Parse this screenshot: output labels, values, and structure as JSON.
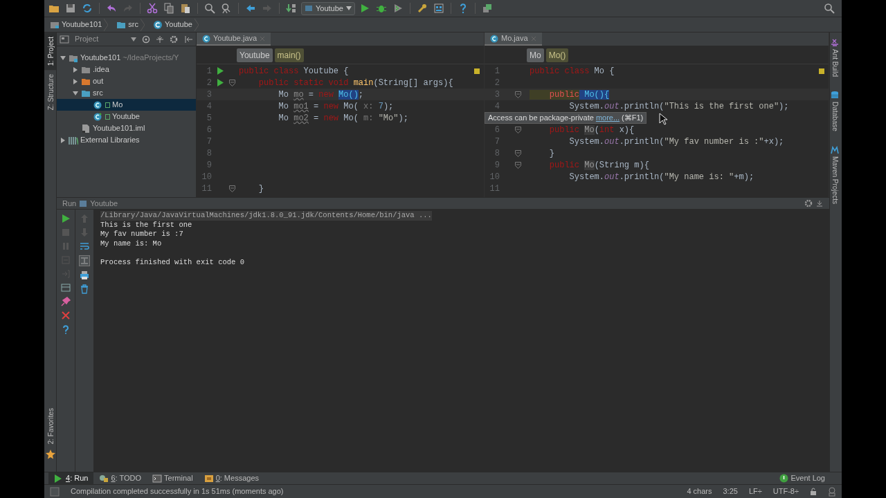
{
  "toolbar": {
    "run_config": "Youtube"
  },
  "breadcrumbs": [
    "Youtube101",
    "src",
    "Youtube"
  ],
  "left_strip": {
    "top": [
      {
        "label": "1: Project",
        "selected": true
      },
      {
        "label": "Z: Structure",
        "selected": false
      }
    ],
    "bottom": [
      {
        "label": "2: Favorites",
        "selected": false
      }
    ]
  },
  "right_strip": [
    {
      "label": "Ant Build",
      "kind": "ant"
    },
    {
      "label": "Database",
      "kind": "database"
    },
    {
      "label": "Maven Projects",
      "kind": "maven"
    }
  ],
  "project_panel": {
    "title": "Project",
    "tree": [
      {
        "label": "Youtube101",
        "hint": "~/IdeaProjects/Y",
        "kind": "module",
        "expanded": true,
        "selected": false,
        "children": [
          {
            "label": ".idea",
            "kind": "folder",
            "expanded": false,
            "selected": false
          },
          {
            "label": "out",
            "kind": "excluded",
            "expanded": false,
            "selected": false
          },
          {
            "label": "src",
            "kind": "source",
            "expanded": true,
            "selected": false,
            "children": [
              {
                "label": "Mo",
                "kind": "class",
                "selected": true
              },
              {
                "label": "Youtube",
                "kind": "main-class",
                "selected": false
              }
            ]
          },
          {
            "label": "Youtube101.iml",
            "kind": "file",
            "selected": false
          }
        ]
      },
      {
        "label": "External Libraries",
        "kind": "library",
        "expanded": false,
        "selected": false
      }
    ]
  },
  "editors": [
    {
      "tab": {
        "label": "Youtube.java",
        "selected": true
      },
      "crumbs": [
        {
          "label": "Youtube",
          "kind": "class"
        },
        {
          "label": "main()",
          "kind": "method"
        }
      ],
      "lines": [
        {
          "n": "1",
          "run": true,
          "tokens": [
            {
              "kind": "kw",
              "t": "public class"
            },
            {
              "kind": "plain",
              "t": " Youtube {"
            }
          ]
        },
        {
          "n": "2",
          "run": true,
          "fold": true,
          "tokens": [
            {
              "kind": "kw",
              "t": "    public static void "
            },
            {
              "kind": "method",
              "t": "main"
            },
            {
              "kind": "plain",
              "t": "(String[] args){"
            }
          ]
        },
        {
          "n": "3",
          "current": true,
          "tokens": [
            {
              "kind": "plain",
              "t": "        Mo "
            },
            {
              "kind": "unused",
              "t": "mo"
            },
            {
              "kind": "plain",
              "t": " = "
            },
            {
              "kind": "kw",
              "t": "new "
            },
            {
              "kind": "sel",
              "t": "Mo()"
            },
            {
              "kind": "plain",
              "t": ";"
            }
          ]
        },
        {
          "n": "4",
          "tokens": [
            {
              "kind": "plain",
              "t": "        Mo "
            },
            {
              "kind": "unused",
              "t": "mo1"
            },
            {
              "kind": "plain",
              "t": " = "
            },
            {
              "kind": "kw",
              "t": "new"
            },
            {
              "kind": "plain",
              "t": " Mo( "
            },
            {
              "kind": "hint",
              "t": "x: "
            },
            {
              "kind": "num",
              "t": "7"
            },
            {
              "kind": "plain",
              "t": ");"
            }
          ]
        },
        {
          "n": "5",
          "tokens": [
            {
              "kind": "plain",
              "t": "        Mo "
            },
            {
              "kind": "unused",
              "t": "mo2"
            },
            {
              "kind": "plain",
              "t": " = "
            },
            {
              "kind": "kw",
              "t": "new"
            },
            {
              "kind": "plain",
              "t": " Mo( "
            },
            {
              "kind": "hint",
              "t": "m:"
            },
            {
              "kind": "str",
              "t": " \"Mo\""
            },
            {
              "kind": "plain",
              "t": ");"
            }
          ]
        },
        {
          "n": "6"
        },
        {
          "n": "7"
        },
        {
          "n": "8"
        },
        {
          "n": "9"
        },
        {
          "n": "10"
        },
        {
          "n": "11",
          "fold": true,
          "tokens": [
            {
              "kind": "plain",
              "t": "    }"
            }
          ]
        }
      ]
    },
    {
      "tab": {
        "label": "Mo.java",
        "selected": true
      },
      "crumbs": [
        {
          "label": "Mo",
          "kind": "class"
        },
        {
          "label": "Mo()",
          "kind": "method"
        }
      ],
      "lines": [
        {
          "n": "1",
          "tokens": [
            {
              "kind": "kw",
              "t": "public class"
            },
            {
              "kind": "plain",
              "t": " Mo {"
            }
          ]
        },
        {
          "n": "2"
        },
        {
          "n": "3",
          "current": true,
          "fold": true,
          "tokens": [
            {
              "kind": "warn",
              "t": "    public"
            },
            {
              "kind": "sel",
              "t": " Mo(){"
            }
          ]
        },
        {
          "n": "4",
          "tokens": [
            {
              "kind": "plain",
              "t": "        System."
            },
            {
              "kind": "field",
              "t": "out"
            },
            {
              "kind": "plain",
              "t": ".println("
            },
            {
              "kind": "str",
              "t": "\"This is the first one\""
            },
            {
              "kind": "plain",
              "t": ");"
            }
          ]
        },
        {
          "covered": true
        },
        {
          "n": "6",
          "fold": true,
          "tokens": [
            {
              "kind": "kw",
              "t": "    public "
            },
            {
              "kind": "usage",
              "t": "Mo"
            },
            {
              "kind": "plain",
              "t": "("
            },
            {
              "kind": "kw",
              "t": "int"
            },
            {
              "kind": "plain",
              "t": " x){"
            }
          ]
        },
        {
          "n": "7",
          "tokens": [
            {
              "kind": "plain",
              "t": "        System."
            },
            {
              "kind": "field",
              "t": "out"
            },
            {
              "kind": "plain",
              "t": ".println("
            },
            {
              "kind": "str",
              "t": "\"My fav number is :\""
            },
            {
              "kind": "plain",
              "t": "+x);"
            }
          ]
        },
        {
          "n": "8",
          "fold": true,
          "tokens": [
            {
              "kind": "plain",
              "t": "    }"
            }
          ]
        },
        {
          "n": "9",
          "fold": true,
          "tokens": [
            {
              "kind": "kw",
              "t": "    public "
            },
            {
              "kind": "usage",
              "t": "Mo"
            },
            {
              "kind": "plain",
              "t": "(String m){"
            }
          ]
        },
        {
          "n": "10",
          "tokens": [
            {
              "kind": "plain",
              "t": "        System."
            },
            {
              "kind": "field",
              "t": "out"
            },
            {
              "kind": "plain",
              "t": ".println("
            },
            {
              "kind": "str",
              "t": "\"My name is: \""
            },
            {
              "kind": "plain",
              "t": "+m);"
            }
          ]
        },
        {
          "n": "11"
        }
      ]
    }
  ],
  "tooltip": {
    "text": "Access can be package-private",
    "link": "more...",
    "shortcut": "(⌘F1)"
  },
  "run_panel": {
    "title": "Run",
    "config": "Youtube",
    "output": [
      {
        "kind": "command",
        "text": "/Library/Java/JavaVirtualMachines/jdk1.8.0_91.jdk/Contents/Home/bin/java ..."
      },
      {
        "kind": "stdout",
        "text": "This is the first one"
      },
      {
        "kind": "stdout",
        "text": "My fav number is :7"
      },
      {
        "kind": "stdout",
        "text": "My name is: Mo"
      },
      {
        "kind": "exit",
        "text": "Process finished with exit code 0"
      }
    ]
  },
  "tool_tabs": [
    {
      "mnemonic": "4",
      "label": ": Run",
      "kind": "run",
      "selected": true
    },
    {
      "mnemonic": "6",
      "label": ": TODO",
      "kind": "todo",
      "selected": false
    },
    {
      "label": "Terminal",
      "kind": "terminal",
      "selected": false
    },
    {
      "mnemonic": "0",
      "label": ": Messages",
      "kind": "messages",
      "selected": false
    }
  ],
  "event_log": "Event Log",
  "status_bar": {
    "message": "Compilation completed successfully in 1s 51ms (moments ago)",
    "items": [
      "4 chars",
      "3:25",
      "LF÷",
      "UTF-8÷"
    ]
  }
}
